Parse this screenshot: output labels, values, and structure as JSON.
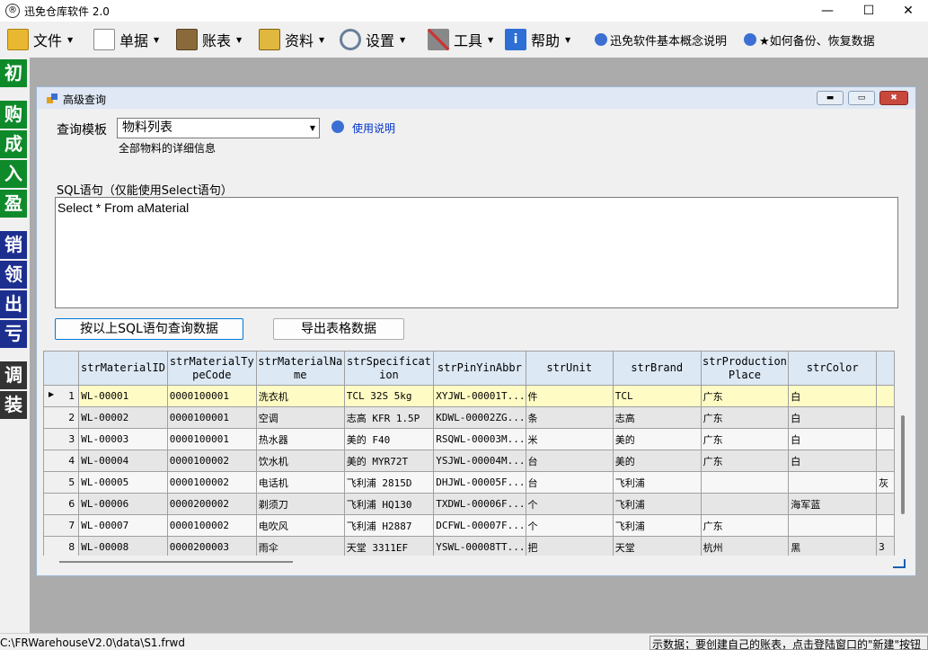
{
  "window": {
    "title": "迅免仓库软件 2.0",
    "minimize": "—",
    "maximize": "☐",
    "close": "✕"
  },
  "menus": [
    {
      "label": "文件",
      "icon": "folder-icon"
    },
    {
      "label": "单据",
      "icon": "document-icon"
    },
    {
      "label": "账表",
      "icon": "ledger-book-icon"
    },
    {
      "label": "资料",
      "icon": "binder-icon"
    },
    {
      "label": "设置",
      "icon": "gear-icon"
    },
    {
      "label": "工具",
      "icon": "tools-icon"
    },
    {
      "label": "帮助",
      "icon": "info-icon"
    }
  ],
  "links": [
    {
      "label": "迅免软件基本概念说明"
    },
    {
      "label": "★如何备份、恢复数据"
    }
  ],
  "leftbar": [
    "初",
    "购",
    "成",
    "入",
    "盈",
    "销",
    "领",
    "出",
    "亏",
    "调",
    "装"
  ],
  "child": {
    "title": "高级查询",
    "template_label": "查询模板",
    "template_value": "物料列表",
    "template_desc": "全部物料的详细信息",
    "help_link": "使用说明",
    "sql_label": "SQL语句（仅能使用Select语句）",
    "sql_text": "Select * From aMaterial",
    "query_button": "按以上SQL语句查询数据",
    "export_button": "导出表格数据"
  },
  "grid": {
    "columns": [
      "strMaterialID",
      "strMaterialTypeCode",
      "strMaterialName",
      "strSpecification",
      "strPinYinAbbr",
      "strUnit",
      "strBrand",
      "strProductionPlace",
      "strColor"
    ],
    "rows": [
      [
        "1",
        "WL-00001",
        "0000100001",
        "洗衣机",
        "TCL 32S 5kg",
        "XYJWL-00001T...",
        "件",
        "TCL",
        "广东",
        "白",
        ""
      ],
      [
        "2",
        "WL-00002",
        "0000100001",
        "空调",
        "志高 KFR 1.5P",
        "KDWL-00002ZG...",
        "条",
        "志高",
        "广东",
        "白",
        ""
      ],
      [
        "3",
        "WL-00003",
        "0000100001",
        "热水器",
        "美的 F40",
        "RSQWL-00003M...",
        "米",
        "美的",
        "广东",
        "白",
        ""
      ],
      [
        "4",
        "WL-00004",
        "0000100002",
        "饮水机",
        "美的 MYR72T",
        "YSJWL-00004M...",
        "台",
        "美的",
        "广东",
        "白",
        ""
      ],
      [
        "5",
        "WL-00005",
        "0000100002",
        "电话机",
        "飞利浦 2815D",
        "DHJWL-00005F...",
        "台",
        "飞利浦",
        "",
        "",
        "灰"
      ],
      [
        "6",
        "WL-00006",
        "0000200002",
        "剃须刀",
        "飞利浦 HQ130",
        "TXDWL-00006F...",
        "个",
        "飞利浦",
        "",
        "海军蓝",
        ""
      ],
      [
        "7",
        "WL-00007",
        "0000100002",
        "电吹风",
        "飞利浦 H2887",
        "DCFWL-00007F...",
        "个",
        "飞利浦",
        "广东",
        "",
        ""
      ],
      [
        "8",
        "WL-00008",
        "0000200003",
        "雨伞",
        "天堂 3311EF",
        "YSWL-00008TT...",
        "把",
        "天堂",
        "杭州",
        "黑",
        "3"
      ]
    ]
  },
  "status": {
    "path": "C:\\FRWarehouseV2.0\\data\\S1.frwd",
    "tip": "示数据；要创建自己的账表，点击登陆窗口的\"新建\"按钮"
  }
}
